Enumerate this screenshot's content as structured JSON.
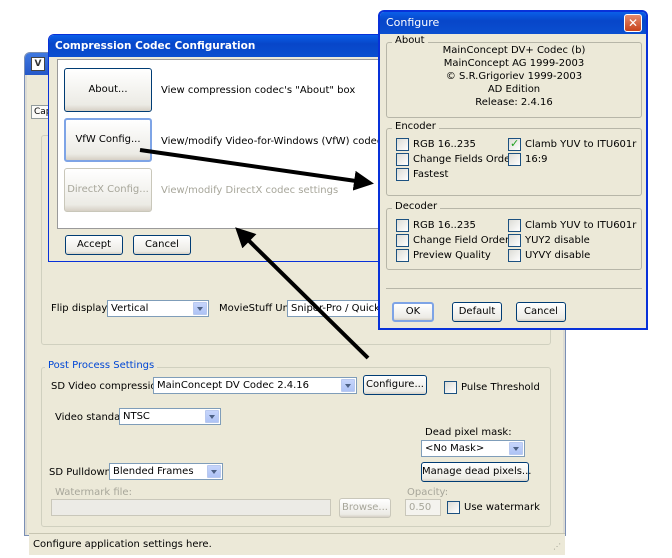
{
  "main": {
    "tab_label": "Cap",
    "flip_display": {
      "label": "Flip display:",
      "value": "Vertical"
    },
    "moviestuff": {
      "label": "MovieStuff Unit:",
      "value": "Sniper-Pro / QuickSilv"
    },
    "post_process": {
      "title": "Post Process Settings",
      "sd_video_compression_label": "SD Video compression:",
      "sd_video_compression_value": "MainConcept DV Codec 2.4.16",
      "configure_button": "Configure...",
      "pulse_threshold_label": "Pulse Threshold",
      "video_standard_label": "Video standard:",
      "video_standard_value": "NTSC",
      "dead_pixel_mask_label": "Dead pixel mask:",
      "dead_pixel_mask_value": "<No Mask>",
      "manage_dead_pixels_button": "Manage dead pixels...",
      "sd_pulldown_label": "SD Pulldown:",
      "sd_pulldown_value": "Blended Frames",
      "watermark_file_label": "Watermark file:",
      "opacity_label": "Opacity:",
      "opacity_value": "0.50",
      "browse_button": "Browse...",
      "use_watermark_label": "Use watermark"
    },
    "status_text": "Configure application settings here."
  },
  "codec": {
    "title": "Compression Codec Configuration",
    "about_button": "About...",
    "about_desc": "View compression codec's \"About\" box",
    "vfw_button": "VfW Config...",
    "vfw_desc": "View/modify Video-for-Windows (VfW) codec settings",
    "directx_button": "DirectX Config...",
    "directx_desc": "View/modify DirectX codec settings",
    "accept_button": "Accept",
    "cancel_button": "Cancel"
  },
  "configure": {
    "title": "Configure",
    "about": {
      "title": "About",
      "lines": [
        "MainConcept DV+ Codec (b)",
        "MainConcept AG 1999-2003",
        "© S.R.Grigoriev 1999-2003",
        "AD Edition",
        "Release: 2.4.16"
      ]
    },
    "encoder": {
      "title": "Encoder",
      "options": [
        {
          "label": "RGB 16..235",
          "checked": false
        },
        {
          "label": "Clamb YUV to ITU601r",
          "checked": true
        },
        {
          "label": "Change Fields Order",
          "checked": false
        },
        {
          "label": "16:9",
          "checked": false
        },
        {
          "label": "Fastest",
          "checked": false
        }
      ]
    },
    "decoder": {
      "title": "Decoder",
      "options": [
        {
          "label": "RGB 16..235",
          "checked": false
        },
        {
          "label": "Clamb YUV to ITU601r",
          "checked": false
        },
        {
          "label": "Change Field Order",
          "checked": false
        },
        {
          "label": "YUY2 disable",
          "checked": false
        },
        {
          "label": "Preview Quality",
          "checked": false
        },
        {
          "label": "UYVY disable",
          "checked": false
        }
      ]
    },
    "ok_button": "OK",
    "default_button": "Default",
    "cancel_button": "Cancel"
  }
}
